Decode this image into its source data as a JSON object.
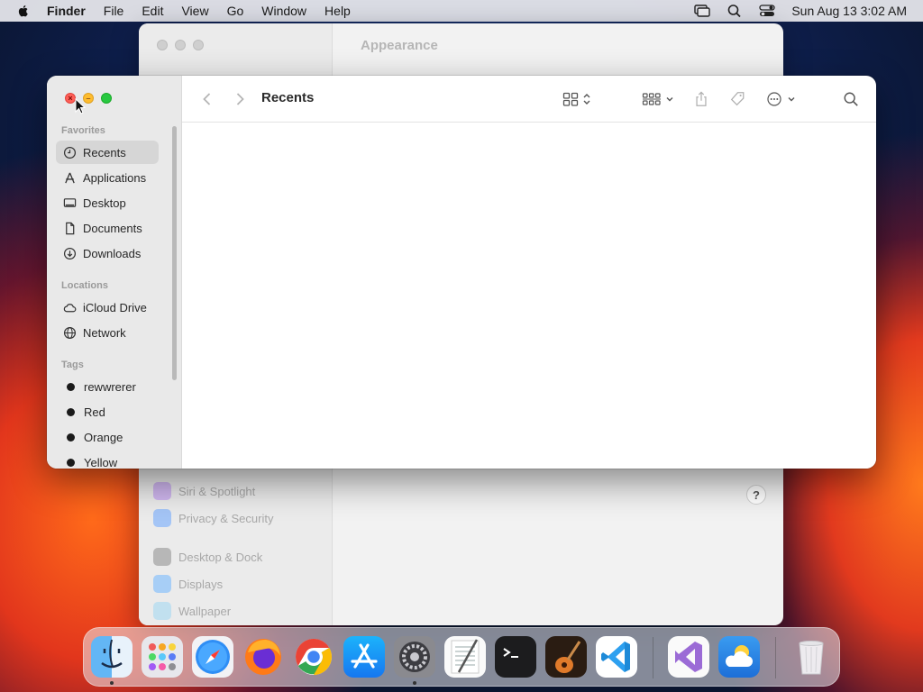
{
  "menubar": {
    "app_name": "Finder",
    "items": [
      "File",
      "Edit",
      "View",
      "Go",
      "Window",
      "Help"
    ],
    "clock": "Sun Aug 13  3:02 AM"
  },
  "settings_window": {
    "title": "Appearance",
    "rows": [
      {
        "label": "Siri & Spotlight",
        "color": "#b88af0"
      },
      {
        "label": "Privacy & Security",
        "color": "#6aa5ff"
      },
      {
        "label": "Desktop & Dock",
        "color": "#8c8c8c"
      },
      {
        "label": "Displays",
        "color": "#6fb6ff"
      },
      {
        "label": "Wallpaper",
        "color": "#9fd7f3"
      }
    ],
    "help": "?"
  },
  "finder": {
    "title": "Recents",
    "sidebar": {
      "favorites_heading": "Favorites",
      "favorites": [
        {
          "label": "Recents",
          "icon": "clock-icon",
          "active": true
        },
        {
          "label": "Applications",
          "icon": "applications-icon"
        },
        {
          "label": "Desktop",
          "icon": "desktop-icon"
        },
        {
          "label": "Documents",
          "icon": "document-icon"
        },
        {
          "label": "Downloads",
          "icon": "download-icon"
        }
      ],
      "locations_heading": "Locations",
      "locations": [
        {
          "label": "iCloud Drive",
          "icon": "cloud-icon"
        },
        {
          "label": "Network",
          "icon": "globe-icon"
        }
      ],
      "tags_heading": "Tags",
      "tags": [
        {
          "label": "rewwrerer"
        },
        {
          "label": "Red"
        },
        {
          "label": "Orange"
        },
        {
          "label": "Yellow"
        }
      ]
    }
  },
  "dock": {
    "apps": [
      "Finder",
      "Launchpad",
      "Safari",
      "Firefox",
      "Chrome",
      "App Store",
      "System Settings",
      "TextEdit",
      "Terminal",
      "GarageBand",
      "Visual Studio Code",
      "Visual Studio",
      "Weather",
      "Trash"
    ]
  }
}
